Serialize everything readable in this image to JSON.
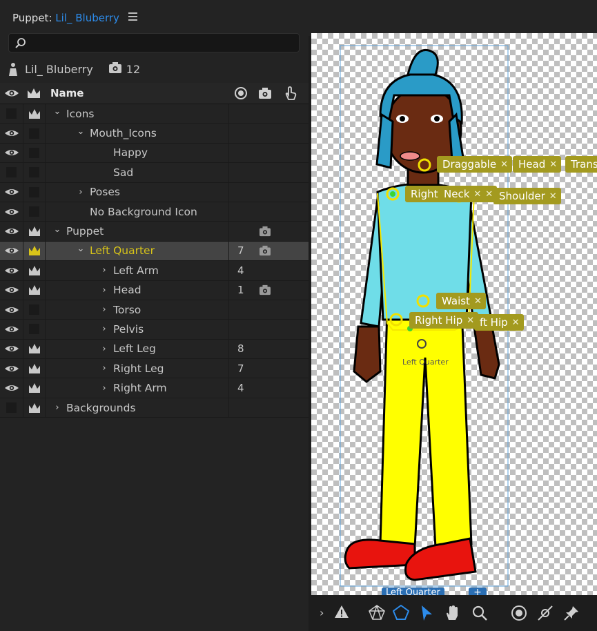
{
  "panel": {
    "title_prefix": "Puppet:",
    "puppet_name": "Lil_ Bluberry"
  },
  "search": {
    "placeholder": ""
  },
  "puppet_info": {
    "name": "Lil_ Bluberry",
    "count": "12"
  },
  "columns": {
    "name": "Name"
  },
  "rows": [
    {
      "label": "Icons",
      "indent": 0,
      "chevron": "down",
      "eye": false,
      "crown": true,
      "num": "",
      "cam": false
    },
    {
      "label": "Mouth_Icons",
      "indent": 1,
      "chevron": "down",
      "eye": true,
      "crown": false,
      "num": "",
      "cam": false
    },
    {
      "label": "Happy",
      "indent": 2,
      "chevron": "",
      "eye": true,
      "crown": false,
      "num": "",
      "cam": false
    },
    {
      "label": "Sad",
      "indent": 2,
      "chevron": "",
      "eye": false,
      "crown": false,
      "num": "",
      "cam": false
    },
    {
      "label": "Poses",
      "indent": 1,
      "chevron": "right",
      "eye": true,
      "crown": false,
      "num": "",
      "cam": false
    },
    {
      "label": "No Background Icon",
      "indent": 1,
      "chevron": "",
      "eye": true,
      "crown": false,
      "num": "",
      "cam": false
    },
    {
      "label": "Puppet",
      "indent": 0,
      "chevron": "down",
      "eye": true,
      "crown": true,
      "num": "",
      "cam": true
    },
    {
      "label": "Left Quarter",
      "indent": 1,
      "chevron": "down",
      "eye": true,
      "crown": true,
      "num": "7",
      "cam": true,
      "selected": true
    },
    {
      "label": "Left Arm",
      "indent": 2,
      "chevron": "right",
      "eye": true,
      "crown": true,
      "num": "4",
      "cam": false
    },
    {
      "label": "Head",
      "indent": 2,
      "chevron": "right",
      "eye": true,
      "crown": true,
      "num": "1",
      "cam": true
    },
    {
      "label": "Torso",
      "indent": 2,
      "chevron": "right",
      "eye": true,
      "crown": false,
      "num": "",
      "cam": false
    },
    {
      "label": "Pelvis",
      "indent": 2,
      "chevron": "right",
      "eye": true,
      "crown": false,
      "num": "",
      "cam": false
    },
    {
      "label": "Left Leg",
      "indent": 2,
      "chevron": "right",
      "eye": true,
      "crown": true,
      "num": "8",
      "cam": false
    },
    {
      "label": "Right Leg",
      "indent": 2,
      "chevron": "right",
      "eye": true,
      "crown": true,
      "num": "7",
      "cam": false
    },
    {
      "label": "Right Arm",
      "indent": 2,
      "chevron": "right",
      "eye": true,
      "crown": true,
      "num": "4",
      "cam": false
    },
    {
      "label": "Backgrounds",
      "indent": 0,
      "chevron": "right",
      "eye": false,
      "crown": true,
      "num": "",
      "cam": false
    }
  ],
  "handle_tags": {
    "draggable": "Draggable",
    "head": "Head",
    "transform": "Trans",
    "right": "Right",
    "neck": "Neck",
    "shoulder": "Shoulder",
    "waist": "Waist",
    "right_hip": "Right Hip",
    "left_hip": "ft Hip",
    "close_glyph": "✕"
  },
  "origin_label": "Left Quarter",
  "tabs": {
    "left_quarter": "Left Quarter",
    "plus": "+"
  },
  "colors": {
    "accent_blue": "#2d8ceb",
    "tag": "#a39a1f",
    "selected_text": "#d8c419",
    "handle": "#f0e000"
  }
}
